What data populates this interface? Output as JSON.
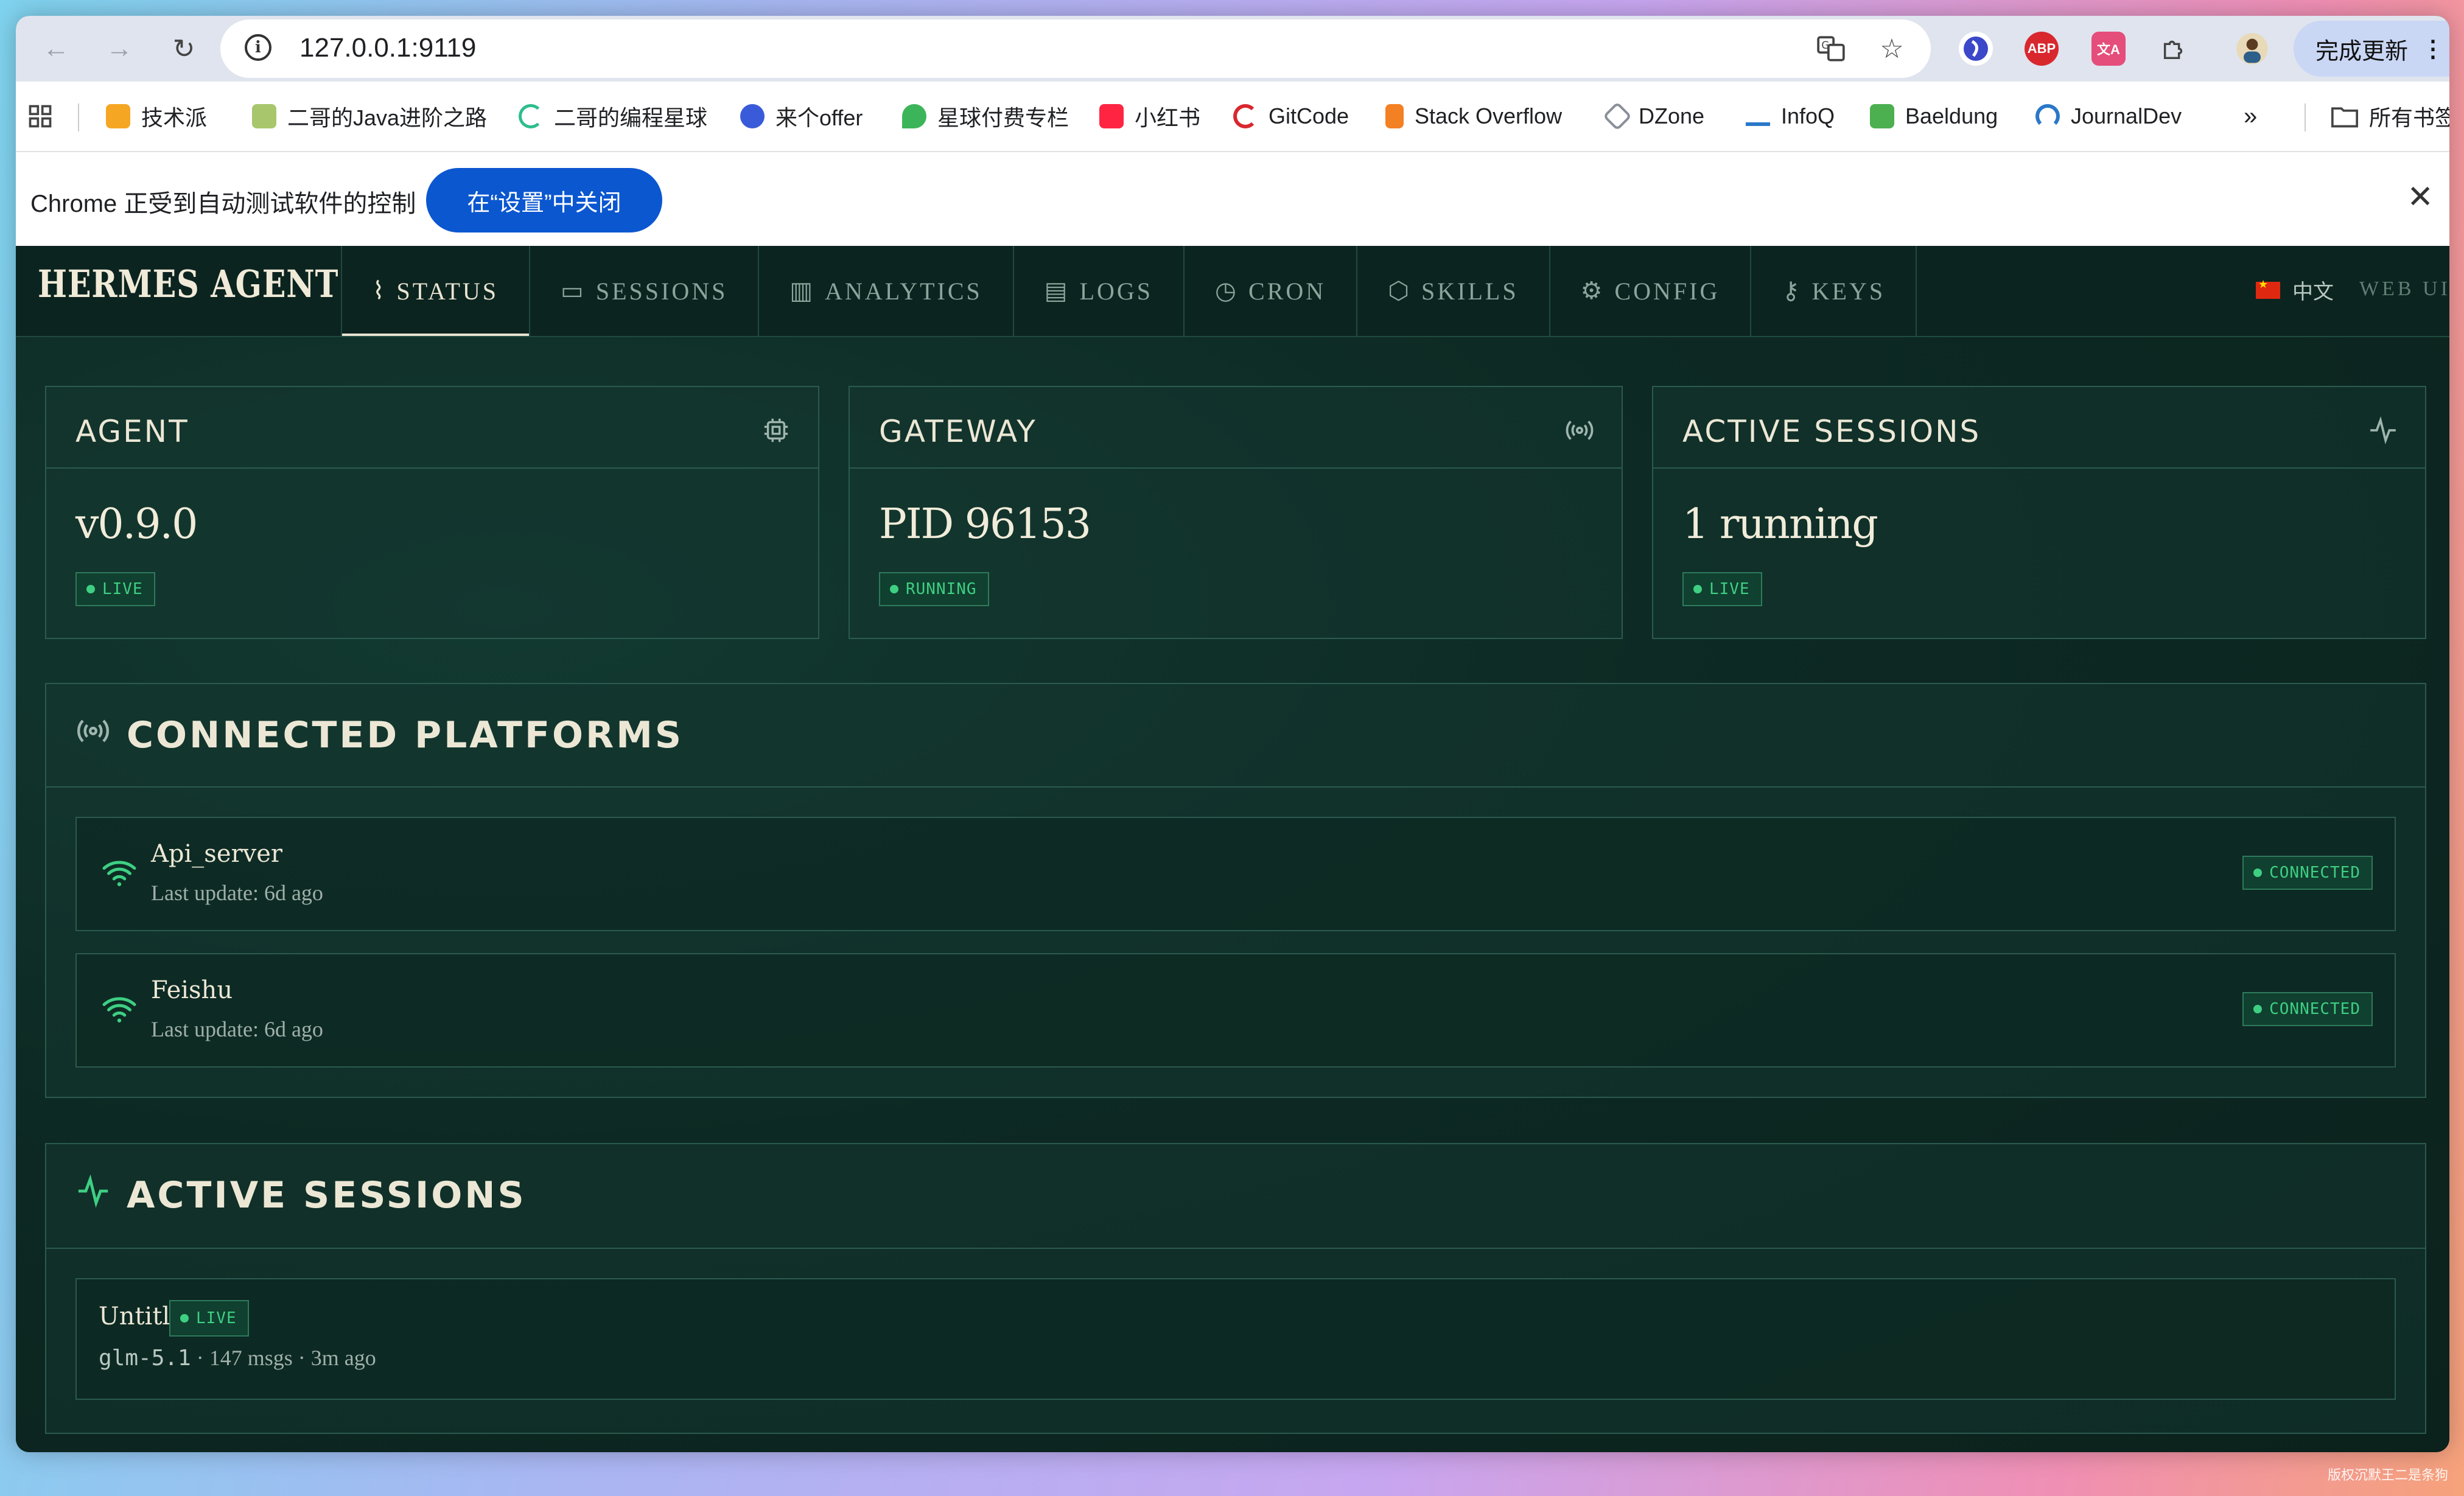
{
  "browser": {
    "url": "127.0.0.1:9119",
    "update_label": "完成更新",
    "bookmarks": [
      "技术派",
      "二哥的Java进阶之路",
      "二哥的编程星球",
      "来个offer",
      "星球付费专栏",
      "小红书",
      "GitCode",
      "Stack Overflow",
      "DZone",
      "InfoQ",
      "Baeldung",
      "JournalDev"
    ],
    "bookmarks_more": "»",
    "all_bookmarks": "所有书签",
    "infobar_text": "Chrome 正受到自动测试软件的控制",
    "infobar_button": "在“设置”中关闭",
    "ext_abp": "ABP",
    "ext_translate": "文A"
  },
  "app": {
    "brand": "HERMES AGENT",
    "nav": [
      {
        "label": "STATUS",
        "icon": "activity-icon",
        "active": true
      },
      {
        "label": "SESSIONS",
        "icon": "chat-icon"
      },
      {
        "label": "ANALYTICS",
        "icon": "bar-chart-icon"
      },
      {
        "label": "LOGS",
        "icon": "document-icon"
      },
      {
        "label": "CRON",
        "icon": "clock-icon"
      },
      {
        "label": "SKILLS",
        "icon": "cube-icon"
      },
      {
        "label": "CONFIG",
        "icon": "gear-icon"
      },
      {
        "label": "KEYS",
        "icon": "key-icon"
      }
    ],
    "language": "中文",
    "webui_label": "WEB UI"
  },
  "cards": {
    "agent": {
      "title": "AGENT",
      "value": "v0.9.0",
      "badge": "LIVE",
      "icon": "cpu-icon"
    },
    "gateway": {
      "title": "GATEWAY",
      "value": "PID 96153",
      "badge": "RUNNING",
      "icon": "broadcast-icon"
    },
    "active_sessions": {
      "title": "ACTIVE SESSIONS",
      "value": "1 running",
      "badge": "LIVE",
      "icon": "activity-icon"
    }
  },
  "platforms": {
    "title": "CONNECTED PLATFORMS",
    "items": [
      {
        "name": "Api_server",
        "update": "Last update: 6d ago",
        "status": "CONNECTED"
      },
      {
        "name": "Feishu",
        "update": "Last update: 6d ago",
        "status": "CONNECTED"
      }
    ]
  },
  "sessions": {
    "title": "ACTIVE SESSIONS",
    "items": [
      {
        "name": "Untitled",
        "badge": "LIVE",
        "model": "glm-5.1",
        "meta": " · 147 msgs · 3m ago"
      }
    ]
  },
  "watermark": "版权沉默王二是条狗",
  "colors": {
    "accent_green": "#3ecf83",
    "background": "#0c2520",
    "text": "#ece7d5"
  }
}
